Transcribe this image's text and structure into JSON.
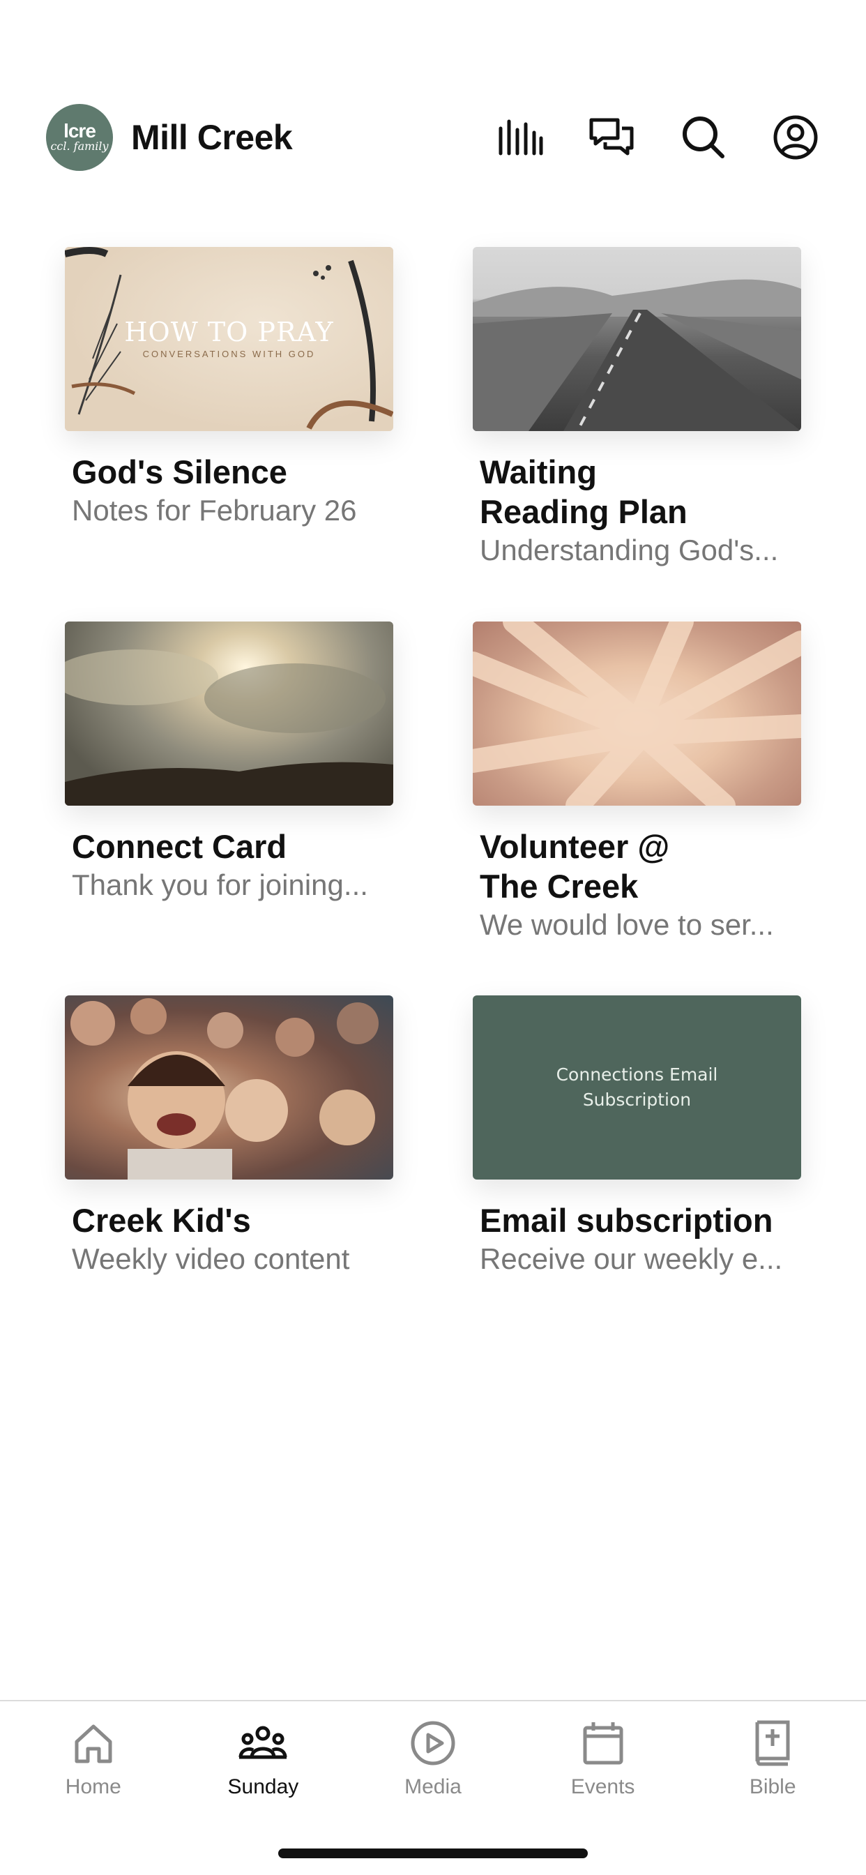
{
  "header": {
    "logo_line1": "lcre",
    "logo_line2": "ccl. family",
    "title": "Mill Creek",
    "icons": [
      "stats-icon",
      "chat-icon",
      "search-icon",
      "profile-icon"
    ]
  },
  "cards": [
    {
      "title": "God's Silence",
      "subtitle": "Notes for February 26",
      "thumb_big": "HOW TO PRAY",
      "thumb_small": "CONVERSATIONS WITH GOD"
    },
    {
      "title": "Waiting\nReading Plan",
      "subtitle": "Understanding God's..."
    },
    {
      "title": "Connect Card",
      "subtitle": "Thank you for joining..."
    },
    {
      "title": "Volunteer @\nThe Creek",
      "subtitle": "We would love to ser..."
    },
    {
      "title": "Creek Kid's",
      "subtitle": "Weekly video content"
    },
    {
      "title": "Email subscription",
      "subtitle": "Receive our weekly e...",
      "thumb_text": "Connections Email\nSubscription"
    }
  ],
  "tabs": [
    {
      "label": "Home",
      "icon": "home-icon",
      "active": false
    },
    {
      "label": "Sunday",
      "icon": "people-icon",
      "active": true
    },
    {
      "label": "Media",
      "icon": "play-icon",
      "active": false
    },
    {
      "label": "Events",
      "icon": "calendar-icon",
      "active": false
    },
    {
      "label": "Bible",
      "icon": "bible-icon",
      "active": false
    }
  ],
  "colors": {
    "brand": "#5f7a6e",
    "active_tab": "#111111",
    "inactive_tab": "#8a8a8a"
  }
}
